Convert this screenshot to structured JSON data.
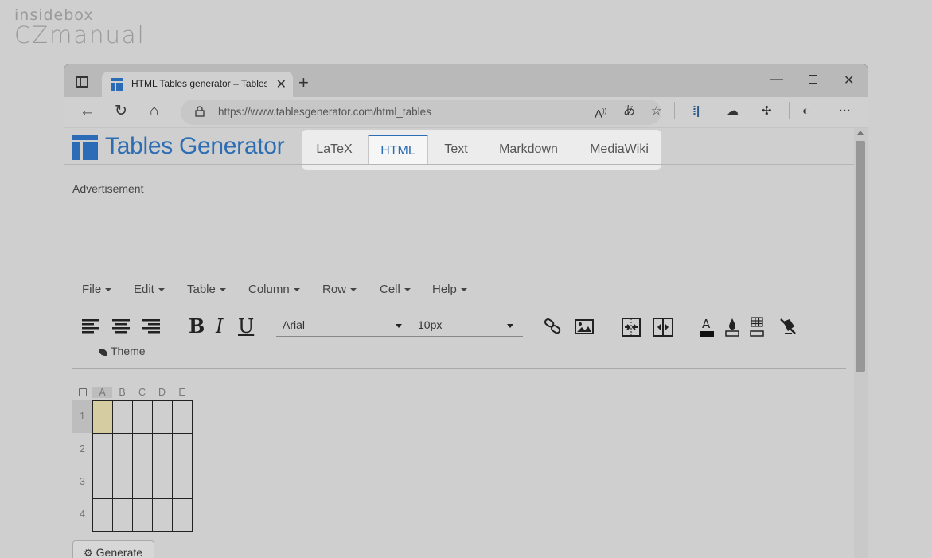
{
  "watermark": {
    "line1": "insidebox",
    "line2": "CZmanual"
  },
  "browser": {
    "tab_title": "HTML Tables generator – TablesGenerator.com",
    "url": "https://www.tablesgenerator.com/html_tables"
  },
  "site": {
    "brand": "Tables Generator",
    "brand_color": "#2d6db3",
    "nav_tabs": [
      {
        "label": "LaTeX",
        "active": false
      },
      {
        "label": "HTML",
        "active": true
      },
      {
        "label": "Text",
        "active": false
      },
      {
        "label": "Markdown",
        "active": false
      },
      {
        "label": "MediaWiki",
        "active": false
      }
    ],
    "advertisement": "Advertisement"
  },
  "editor": {
    "menus": [
      "File",
      "Edit",
      "Table",
      "Column",
      "Row",
      "Cell",
      "Help"
    ],
    "font_family": "Arial",
    "font_size": "10px",
    "bold": "B",
    "italic": "I",
    "underline": "U",
    "theme_label": "Theme",
    "columns": [
      "A",
      "B",
      "C",
      "D",
      "E"
    ],
    "rows": [
      "1",
      "2",
      "3",
      "4"
    ],
    "selected_cell": "A1",
    "selected_color": "#d6cca1",
    "generate_label": "Generate"
  }
}
